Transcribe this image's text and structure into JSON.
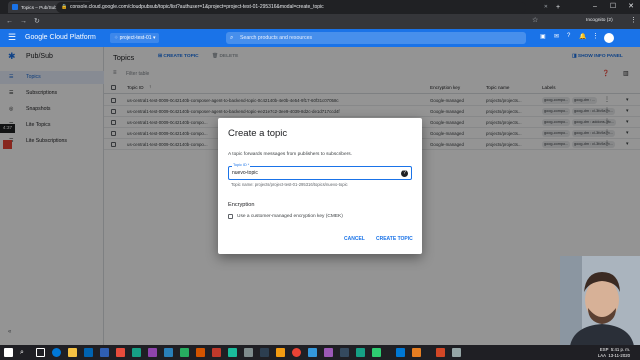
{
  "browser": {
    "tabs": [
      {
        "label": "Topics – Pub/Sub – project-te...",
        "color": "#1a73e8",
        "active": true
      },
      {
        "label": "Free Online GUID Generator",
        "color": "#e37400"
      },
      {
        "label": "repo-test02 - Source",
        "color": "#34a853"
      },
      {
        "label": "Source",
        "color": "#34a853"
      },
      {
        "label": "dags - us-...0b-bucket - Bucke...",
        "color": "#4285f4"
      },
      {
        "label": "Airflow - DAGs",
        "color": "#017cee"
      }
    ],
    "new_tab": "+",
    "url": "console.cloud.google.com/cloudpubsub/topic/list?authuser=1&project=project-test-01-295316&modal=create_topic",
    "profile": "Incognito (2)"
  },
  "gcp": {
    "brand": "Google Cloud Platform",
    "project": "project-test-01",
    "search_placeholder": "Search products and resources"
  },
  "sidebar": {
    "title": "Pub/Sub",
    "items": [
      {
        "label": "Topics",
        "active": true
      },
      {
        "label": "Subscriptions"
      },
      {
        "label": "Snapshots"
      },
      {
        "label": "Lite Topics"
      },
      {
        "label": "Lite Subscriptions"
      }
    ],
    "collapse": "«"
  },
  "main": {
    "title": "Topics",
    "create_button": "CREATE TOPIC",
    "delete_button": "DELETE",
    "info_panel": "SHOW INFO PANEL",
    "filter_placeholder": "Filter table",
    "columns": [
      "Topic ID",
      "Encryption key",
      "Topic name",
      "Labels"
    ],
    "rows": [
      {
        "id": "us-central1-test-0009-0c42140b-composer-agent-to-backend-topic-0c42140b-4e0b-4e54-9f17-60f31c07058c",
        "key": "Google-managed",
        "name": "projects/projects...",
        "chips": [
          "goog-compo...",
          "goog-dm : ..."
        ]
      },
      {
        "id": "us-central1-test-0009-0c42140b-composer-agent-to-backend-topic-ee21e7c2-3ee9-4039-8d2c-de1d717ccd4f",
        "key": "Google-managed",
        "name": "projects/projects...",
        "chips": [
          "goog-compo...",
          "goog-dm : cl-3fc9a7b..."
        ]
      },
      {
        "id": "us-central1-test-0009-0c42140b-compo...",
        "key": "Google-managed",
        "name": "projects/projects...",
        "chips": [
          "goog-compo...",
          "goog-dm : addons-3fc..."
        ]
      },
      {
        "id": "us-central1-test-0009-0c42140b-compo...",
        "key": "Google-managed",
        "name": "projects/projects...",
        "chips": [
          "goog-compo...",
          "goog-dm : cl-3fc9a7b..."
        ]
      },
      {
        "id": "us-central1-test-0009-0c42140b-compo...",
        "key": "Google-managed",
        "name": "projects/projects...",
        "chips": [
          "goog-compo...",
          "goog-dm : cl-3fc9a7b..."
        ]
      }
    ]
  },
  "dialog": {
    "title": "Create a topic",
    "description": "A topic forwards messages from publishers to subscribers.",
    "field_label": "Topic ID *",
    "field_value": "nuevo-topic",
    "field_hint": "Topic name: projects/project-test-01-295316/topics/nuevo-topic",
    "encryption_heading": "Encryption",
    "encryption_option": "Use a customer-managed encryption key (CMEK)",
    "cancel": "CANCEL",
    "create": "CREATE TOPIC"
  },
  "left_badge": "4:37",
  "taskbar": {
    "lang": "ESP",
    "layout": "LAA",
    "time": "5:41 p. m.",
    "date": "13-11-2020"
  }
}
